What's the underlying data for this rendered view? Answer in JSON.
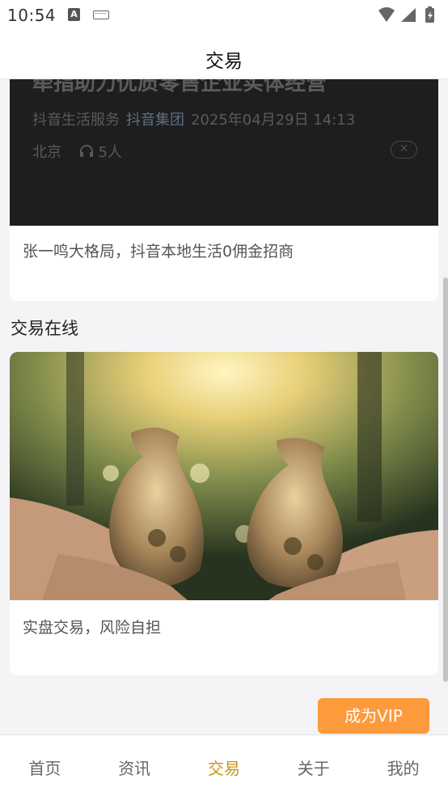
{
  "status_bar": {
    "time": "10:54",
    "input_badge": "A",
    "icons": [
      "a-badge-icon",
      "keyboard-icon",
      "wifi-icon",
      "cell-signal-icon",
      "battery-charging-icon"
    ]
  },
  "header": {
    "title": "交易"
  },
  "news_card": {
    "image_headline": "牵指助力优质零售企业实体经营",
    "image_source": "抖音生活服务",
    "image_org": "抖音集团",
    "image_datetime": "2025年04月29日 14:13",
    "image_location": "北京",
    "image_listeners": "5人",
    "caption": "张一鸣大格局，抖音本地生活0佣金招商"
  },
  "trade_section": {
    "title": "交易在线",
    "card_caption": "实盘交易，风险自担"
  },
  "vip_button": {
    "label": "成为VIP",
    "color": "#fd9a3c"
  },
  "bottom_nav": {
    "items": [
      {
        "label": "首页",
        "active": false
      },
      {
        "label": "资讯",
        "active": false
      },
      {
        "label": "交易",
        "active": true
      },
      {
        "label": "关于",
        "active": false
      },
      {
        "label": "我的",
        "active": false
      }
    ],
    "active_color": "#c8951a"
  }
}
